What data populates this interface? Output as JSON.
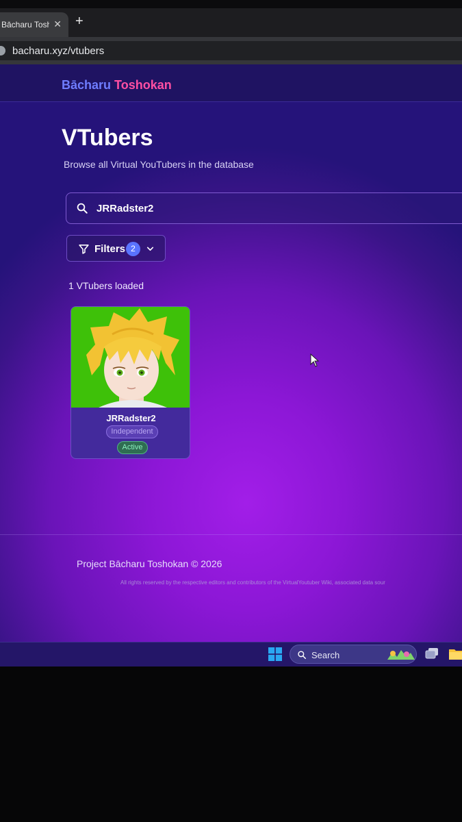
{
  "browser": {
    "tab_title": "Bācharu Toshokan",
    "tab_close": "✕",
    "new_tab": "+",
    "url": "bacharu.xyz/vtubers"
  },
  "site": {
    "brand_part1": "Bācharu",
    "brand_part2": "Toshokan",
    "colors": {
      "brand_blue": "#6f7dff",
      "brand_pink": "#ff4fa3",
      "accent": "#5a73ff",
      "status_active": "#8bf0bf"
    }
  },
  "main": {
    "title": "VTubers",
    "subtitle": "Browse all Virtual YouTubers in the database",
    "search": {
      "value": "JRRadster2",
      "icon": "search-icon"
    },
    "filters": {
      "label": "Filters",
      "count": "2",
      "icon": "filter-icon"
    },
    "loaded_count": "1 VTubers loaded",
    "cards": [
      {
        "name": "JRRadster2",
        "affiliation": "Independent",
        "status": "Active"
      }
    ]
  },
  "footer": {
    "copyright": "Project Bācharu Toshokan © 2026",
    "rights": "All rights reserved by the respective editors and contributors of the VirtualYoutuber Wiki, associated data sour"
  },
  "taskbar": {
    "search_label": "Search"
  }
}
